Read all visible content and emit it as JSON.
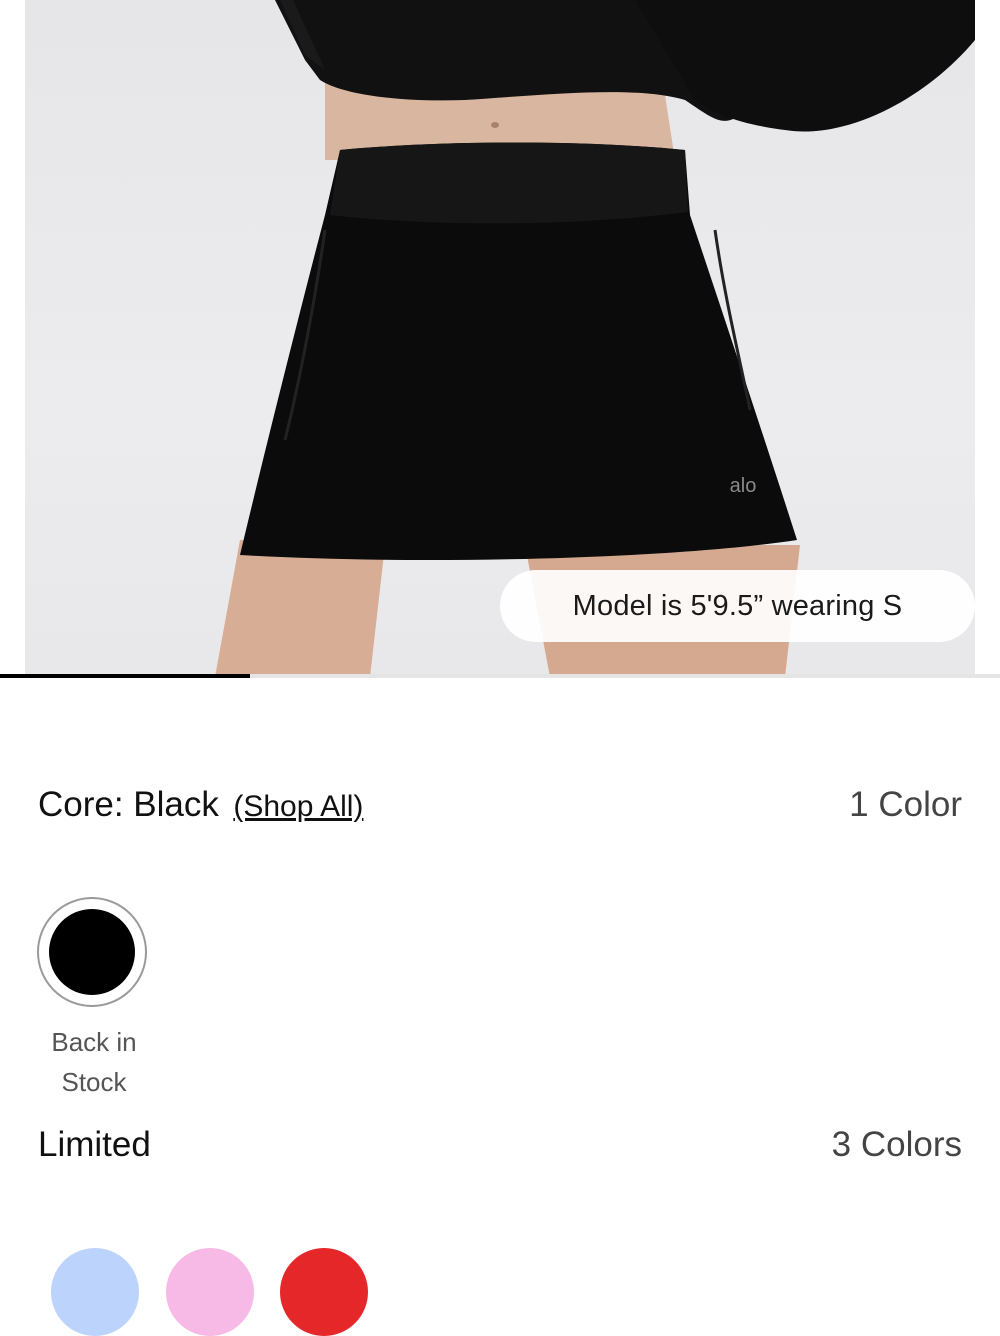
{
  "hero": {
    "model_info": "Model is 5'9.5” wearing S",
    "logo_text": "alo",
    "gallery_progress": 0.25
  },
  "core_section": {
    "title": "Core: Black",
    "shop_all_label": "(Shop All)",
    "count_label": "1 Color",
    "swatches": [
      {
        "color_name": "Black",
        "color": "#000000",
        "caption_line1": "Back in",
        "caption_line2": "Stock",
        "selected": true
      }
    ]
  },
  "limited_section": {
    "title": "Limited",
    "count_label": "3 Colors",
    "swatches": [
      {
        "color": "#bcd4fb"
      },
      {
        "color": "#f7b9e6"
      },
      {
        "color": "#e5272a"
      }
    ]
  }
}
